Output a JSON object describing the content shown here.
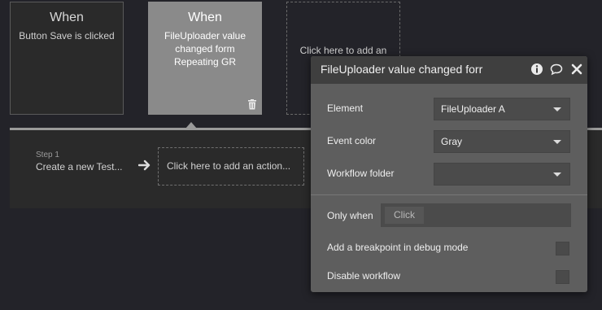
{
  "events": [
    {
      "title": "When",
      "description": "Button Save is clicked"
    },
    {
      "title": "When",
      "description_lines": [
        "FileUploader value",
        "changed form",
        "Repeating GR"
      ]
    },
    {
      "add_text": "Click here to add an"
    }
  ],
  "workflow": {
    "step_label": "Step 1",
    "step_title": "Create a new Test...",
    "add_action": "Click here to add an action..."
  },
  "panel": {
    "title": "FileUploader value changed forr",
    "rows": {
      "element": {
        "label": "Element",
        "value": "FileUploader A"
      },
      "event_color": {
        "label": "Event color",
        "value": "Gray"
      },
      "workflow_folder": {
        "label": "Workflow folder",
        "value": ""
      }
    },
    "only_when": {
      "label": "Only when",
      "placeholder": "Click"
    },
    "breakpoint": {
      "label": "Add a breakpoint in debug mode",
      "checked": false
    },
    "disable": {
      "label": "Disable workflow",
      "checked": false
    }
  },
  "icons": [
    "trash-icon",
    "arrow-right-icon",
    "info-icon",
    "comment-icon",
    "close-icon",
    "chevron-down-icon"
  ],
  "colors": {
    "background": "#232329",
    "selected_event": "#8a8a8a",
    "panel": "#5e5e5e",
    "panel_header": "#3f3f3f"
  }
}
